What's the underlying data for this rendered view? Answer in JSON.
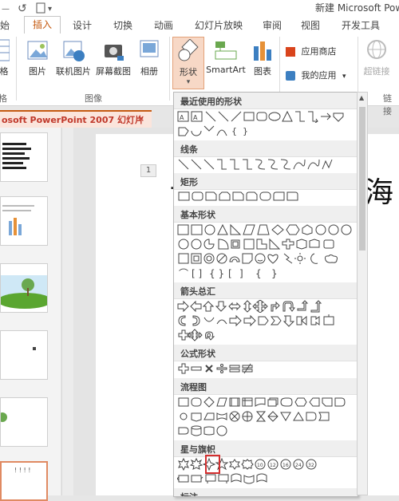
{
  "window": {
    "title": "新建 Microsoft Pow"
  },
  "tabs": [
    {
      "label": "开始",
      "active": false
    },
    {
      "label": "插入",
      "active": true
    },
    {
      "label": "设计",
      "active": false
    },
    {
      "label": "切换",
      "active": false
    },
    {
      "label": "动画",
      "active": false
    },
    {
      "label": "幻灯片放映",
      "active": false
    },
    {
      "label": "审阅",
      "active": false
    },
    {
      "label": "视图",
      "active": false
    },
    {
      "label": "开发工具",
      "active": false
    }
  ],
  "ribbon": {
    "table_label": "格",
    "table_group": "格",
    "picture": "图片",
    "online_picture": "联机图片",
    "screenshot": "屏幕截图",
    "album": "相册",
    "images_group": "图像",
    "shapes": "形状",
    "smartart": "SmartArt",
    "chart": "图表",
    "app_store": "应用商店",
    "my_apps": "我的应用",
    "hyperlink": "超链接",
    "links_group": "链接"
  },
  "document_tab": {
    "title": "osoft PowerPoint 2007 幻灯片",
    "close": "×"
  },
  "slide": {
    "number": "1",
    "char_right": "海",
    "char_left": "…"
  },
  "shape_menu": {
    "sections": [
      "最近使用的形状",
      "线条",
      "矩形",
      "基本形状",
      "箭头总汇",
      "公式形状",
      "流程图",
      "星与旗帜",
      "标注"
    ]
  },
  "colors": {
    "accent": "#c55a11",
    "highlight": "#d32f2f"
  }
}
